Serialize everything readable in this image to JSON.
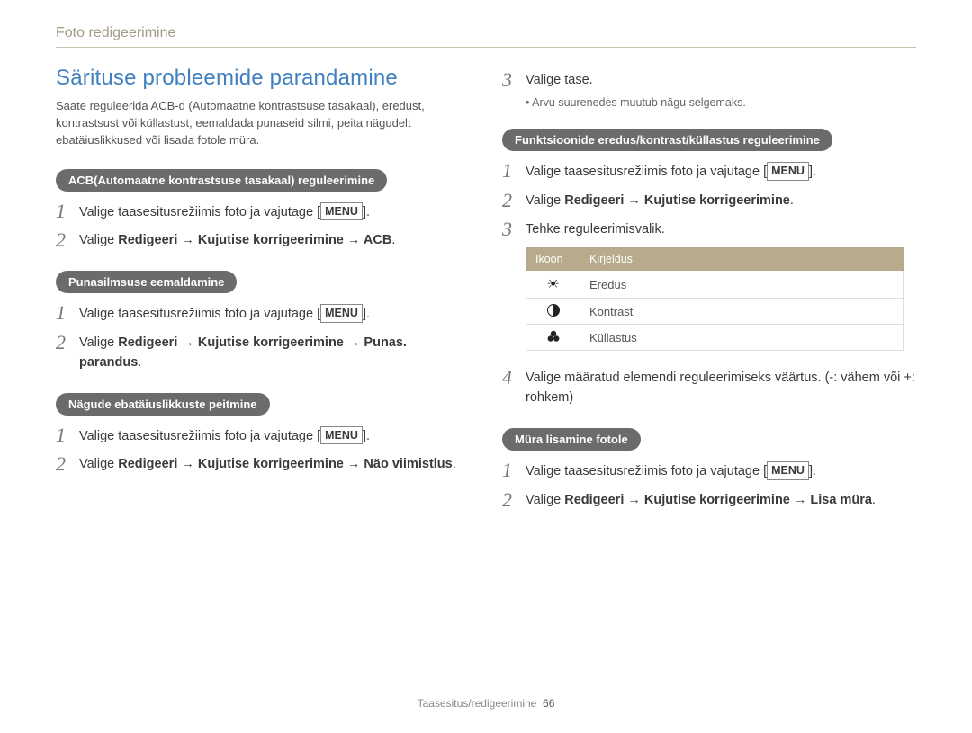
{
  "header": {
    "title": "Foto redigeerimine"
  },
  "left": {
    "title": "Särituse probleemide parandamine",
    "intro": "Saate reguleerida ACB-d (Automaatne kontrastsuse tasakaal), eredust, kontrastsust või küllastust, eemaldada punaseid silmi, peita nägudelt ebatäiuslikkused või lisada fotole müra.",
    "pill1": "ACB(Automaatne kontrastsuse tasakaal) reguleerimine",
    "s1a": "Valige taasesitusrežiimis foto ja vajutage [",
    "s1b": "].",
    "s1c_prefix": "Valige ",
    "s1c_bold": "Redigeeri → Kujutise korrigeerimine → ACB",
    "s1c_suffix": ".",
    "pill2": "Punasilmsuse eemaldamine",
    "s2a": "Valige taasesitusrežiimis foto ja vajutage [",
    "s2b": "].",
    "s2c_prefix": "Valige ",
    "s2c_bold": "Redigeeri → Kujutise korrigeerimine → Punas. parandus",
    "s2c_suffix": ".",
    "pill3": "Nägude ebatäiuslikkuste peitmine",
    "s3a": "Valige taasesitusrežiimis foto ja vajutage [",
    "s3b": "].",
    "s3c_prefix": "Valige ",
    "s3c_bold": "Redigeeri → Kujutise korrigeerimine → Näo viimistlus",
    "s3c_suffix": "."
  },
  "right": {
    "r1": "Valige tase.",
    "r1_sub": "Arvu suurenedes muutub nägu selgemaks.",
    "pill4": "Funktsioonide eredus/kontrast/küllastus reguleerimine",
    "r2a": "Valige taasesitusrežiimis foto ja vajutage [",
    "r2b": "].",
    "r2c_prefix": "Valige ",
    "r2c_bold": "Redigeeri → Kujutise korrigeerimine",
    "r2c_suffix": ".",
    "r2d": "Tehke reguleerimisvalik.",
    "table": {
      "h1": "Ikoon",
      "h2": "Kirjeldus",
      "rows": [
        {
          "desc": "Eredus"
        },
        {
          "desc": "Kontrast"
        },
        {
          "desc": "Küllastus"
        }
      ]
    },
    "r2e": "Valige määratud elemendi reguleerimiseks väärtus. (-: vähem või +: rohkem)",
    "pill5": "Müra lisamine fotole",
    "r3a": "Valige taasesitusrežiimis foto ja vajutage [",
    "r3b": "].",
    "r3c_prefix": "Valige ",
    "r3c_bold": "Redigeeri → Kujutise korrigeerimine → Lisa müra",
    "r3c_suffix": "."
  },
  "menu_label": "MENU",
  "footer": {
    "section": "Taasesitus/redigeerimine",
    "page": "66"
  }
}
